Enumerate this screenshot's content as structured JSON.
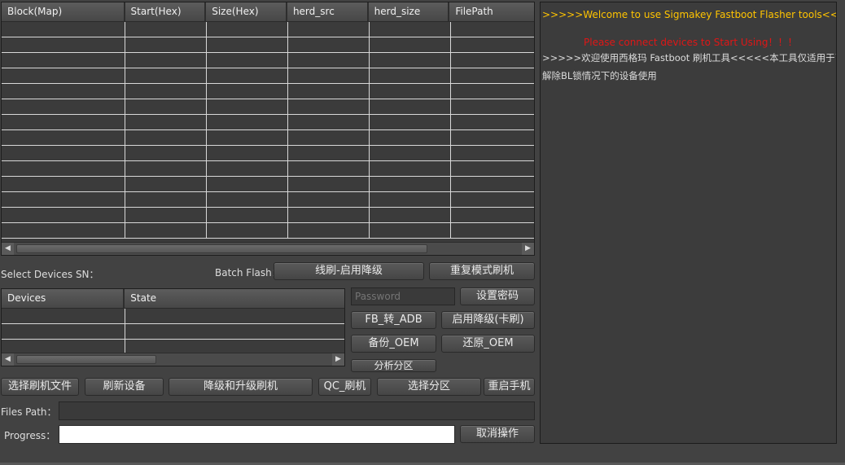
{
  "partition_table": {
    "columns": [
      "Block(Map)",
      "Start(Hex)",
      "Size(Hex)",
      "herd_src",
      "herd_size",
      "FilePath"
    ]
  },
  "device_select": {
    "label": "Select Devices SN："
  },
  "batch_flash": {
    "label": "Batch Flash：",
    "btn_line_flash": "线刷-启用降级",
    "btn_repeat_mode": "重复模式刷机"
  },
  "devices_table": {
    "columns": [
      "Devices",
      "State"
    ]
  },
  "password": {
    "placeholder": "Password",
    "set_button": "设置密码"
  },
  "actions": {
    "fb_to_adb": "FB_转_ADB",
    "enable_downgrade": "启用降级(卡刷)",
    "backup_oem": "备份_OEM",
    "restore_oem": "还原_OEM",
    "analyze_partition": "分析分区"
  },
  "toolbar": {
    "select_file": "选择刷机文件",
    "refresh_device": "刷新设备",
    "downgrade_upgrade": "降级和升级刷机",
    "qc_flash": "QC_刷机",
    "select_partition": "选择分区",
    "reboot_phone": "重启手机"
  },
  "files_path": {
    "label": "Files Path：",
    "value": ""
  },
  "progress": {
    "label": "Progress：",
    "cancel_button": "取消操作",
    "value": 0
  },
  "log": {
    "welcome_en": ">>>>>Welcome to use Sigmakey Fastboot Flasher tools<<<<<",
    "connect_prompt": "Please connect devices to Start Using！！！",
    "welcome_cn_1": ">>>>>欢迎使用西格玛 Fastboot 刷机工具<<<<<本工具仅适用于已经",
    "welcome_cn_2": "解除BL锁情况下的设备使用"
  },
  "colors": {
    "welcome_en": "#ffc400",
    "connect_prompt": "#e01616",
    "log_text": "#dcdcdc"
  }
}
